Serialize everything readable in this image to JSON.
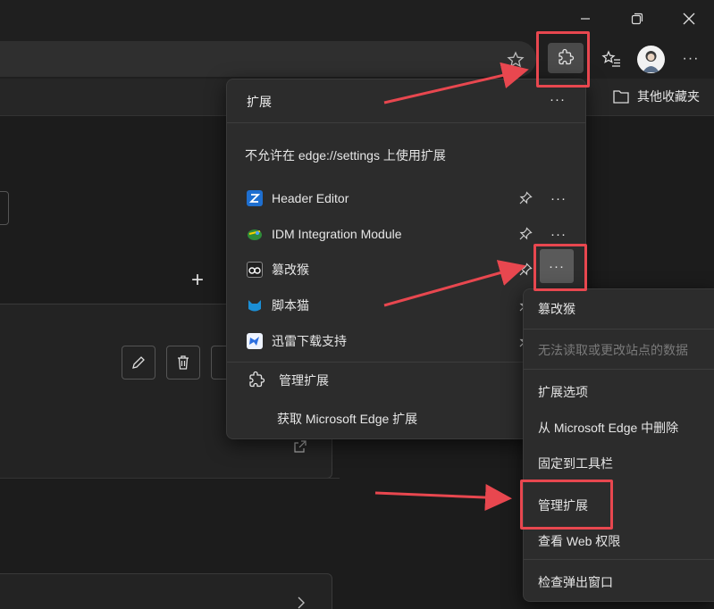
{
  "window": {
    "minimize_icon": "minimize-icon",
    "restore_icon": "restore-icon",
    "close_icon": "close-icon"
  },
  "toolbar": {
    "favorites_icon": "favorites-star-icon",
    "extensions_icon": "puzzle-icon",
    "collections_icon": "favorites-list-icon",
    "avatar": "avatar",
    "more_icon": "more-icon",
    "more_label": "···"
  },
  "favorites_bar": {
    "other_favorites": "其他收藏夹"
  },
  "extensions_panel": {
    "title": "扩展",
    "more_label": "···",
    "notice": "不允许在 edge://settings 上使用扩展",
    "items": [
      {
        "name": "Header Editor",
        "icon": "header-editor-icon",
        "icon_color": "#1e6fd0",
        "dots": "···"
      },
      {
        "name": "IDM Integration Module",
        "icon": "idm-icon",
        "icon_color": "#2e8b3a",
        "dots": "···"
      },
      {
        "name": "篡改猴",
        "icon": "tampermonkey-icon",
        "icon_color": "#3a3a3a",
        "dots": "···"
      },
      {
        "name": "脚本猫",
        "icon": "scriptcat-icon",
        "icon_color": "#1b8fd6",
        "dots": ""
      },
      {
        "name": "迅雷下载支持",
        "icon": "thunder-icon",
        "icon_color": "#2c6fe0",
        "dots": ""
      }
    ],
    "manage": "管理扩展",
    "get_more": "获取 Microsoft Edge 扩展"
  },
  "context_menu": {
    "items": [
      {
        "label": "篡改猴",
        "disabled": false
      },
      {
        "label": "无法读取或更改站点的数据",
        "disabled": true
      },
      {
        "label": "扩展选项",
        "disabled": false
      },
      {
        "label": "从 Microsoft Edge 中删除",
        "disabled": false
      },
      {
        "label": "固定到工具栏",
        "disabled": false
      },
      {
        "label": "管理扩展",
        "disabled": false
      },
      {
        "label": "查看 Web 权限",
        "disabled": false
      },
      {
        "label": "检查弹出窗口",
        "disabled": false
      }
    ]
  },
  "annotation_color": "#e8474f"
}
